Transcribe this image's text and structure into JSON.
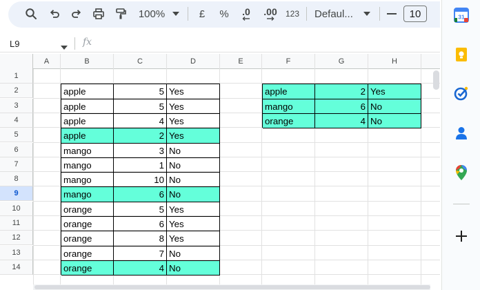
{
  "toolbar": {
    "zoom": "100%",
    "currency": "£",
    "percent": "%",
    "decrease_decimal": ".0",
    "increase_decimal": ".00",
    "number_format": "123",
    "font": "Defaul...",
    "font_size": "10"
  },
  "formula_bar": {
    "cell_ref": "L9",
    "fx": "fx"
  },
  "columns": [
    "A",
    "B",
    "C",
    "D",
    "E",
    "F",
    "G",
    "H"
  ],
  "rows": [
    "1",
    "2",
    "3",
    "4",
    "5",
    "6",
    "7",
    "8",
    "9",
    "10",
    "11",
    "12",
    "13",
    "14"
  ],
  "selected_row": "9",
  "table_left": [
    {
      "row": "2",
      "fruit": "apple",
      "qty": "5",
      "flag": "Yes",
      "highlight": false
    },
    {
      "row": "3",
      "fruit": "apple",
      "qty": "5",
      "flag": "Yes",
      "highlight": false
    },
    {
      "row": "4",
      "fruit": "apple",
      "qty": "4",
      "flag": "Yes",
      "highlight": false
    },
    {
      "row": "5",
      "fruit": "apple",
      "qty": "2",
      "flag": "Yes",
      "highlight": true
    },
    {
      "row": "6",
      "fruit": "mango",
      "qty": "3",
      "flag": "No",
      "highlight": false
    },
    {
      "row": "7",
      "fruit": "mango",
      "qty": "1",
      "flag": "No",
      "highlight": false
    },
    {
      "row": "8",
      "fruit": "mango",
      "qty": "10",
      "flag": "No",
      "highlight": false
    },
    {
      "row": "9",
      "fruit": "mango",
      "qty": "6",
      "flag": "No",
      "highlight": true
    },
    {
      "row": "10",
      "fruit": "orange",
      "qty": "5",
      "flag": "Yes",
      "highlight": false
    },
    {
      "row": "11",
      "fruit": "orange",
      "qty": "6",
      "flag": "Yes",
      "highlight": false
    },
    {
      "row": "12",
      "fruit": "orange",
      "qty": "8",
      "flag": "Yes",
      "highlight": false
    },
    {
      "row": "13",
      "fruit": "orange",
      "qty": "7",
      "flag": "No",
      "highlight": false
    },
    {
      "row": "14",
      "fruit": "orange",
      "qty": "4",
      "flag": "No",
      "highlight": true
    }
  ],
  "table_right": [
    {
      "row": "2",
      "fruit": "apple",
      "qty": "2",
      "flag": "Yes"
    },
    {
      "row": "3",
      "fruit": "mango",
      "qty": "6",
      "flag": "No"
    },
    {
      "row": "4",
      "fruit": "orange",
      "qty": "4",
      "flag": "No"
    }
  ],
  "colors": {
    "highlight": "#64ffda",
    "selected_row_header": "#d3e3fd",
    "toolbar_bg": "#edf2fa"
  },
  "side_panel": {
    "calendar_day": "31",
    "icons": [
      "calendar-icon",
      "keep-icon",
      "tasks-icon",
      "contacts-icon",
      "maps-icon",
      "add-icon"
    ]
  }
}
